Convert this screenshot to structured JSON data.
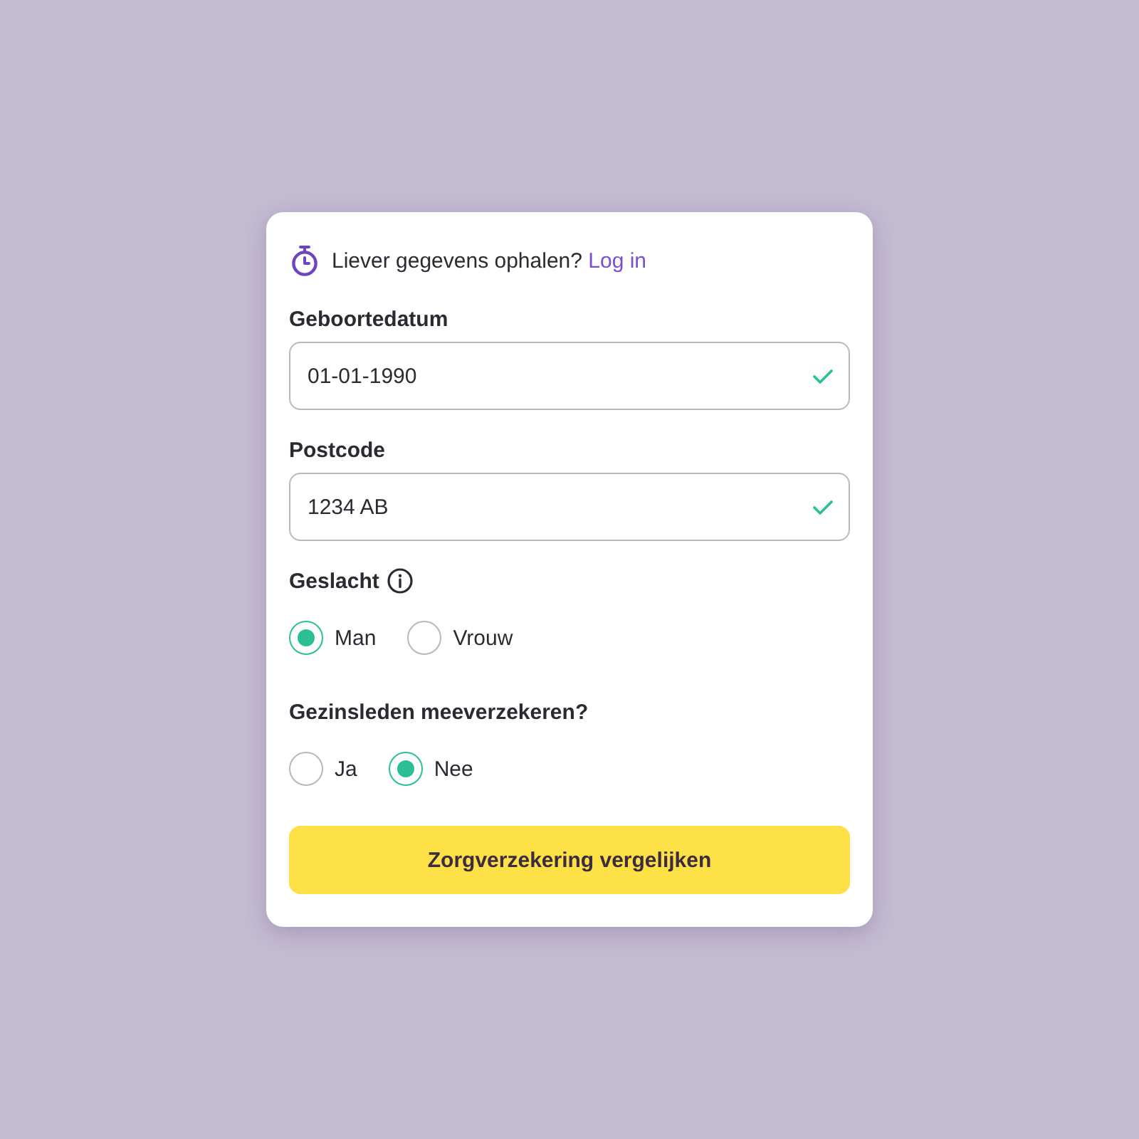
{
  "login_prompt": {
    "text": "Liever gegevens ophalen?",
    "link": "Log in"
  },
  "fields": [
    {
      "label": "Geboortedatum",
      "value": "01-01-1990",
      "valid": true
    },
    {
      "label": "Postcode",
      "value": "1234 AB",
      "valid": true
    }
  ],
  "radio_groups": [
    {
      "label": "Geslacht",
      "info": true,
      "options": [
        {
          "label": "Man",
          "selected": true
        },
        {
          "label": "Vrouw",
          "selected": false
        }
      ]
    },
    {
      "label": "Gezinsleden meeverzekeren?",
      "info": false,
      "options": [
        {
          "label": "Ja",
          "selected": false
        },
        {
          "label": "Nee",
          "selected": true
        }
      ]
    }
  ],
  "submit_button": {
    "label": "Zorgverzekering vergelijken"
  }
}
